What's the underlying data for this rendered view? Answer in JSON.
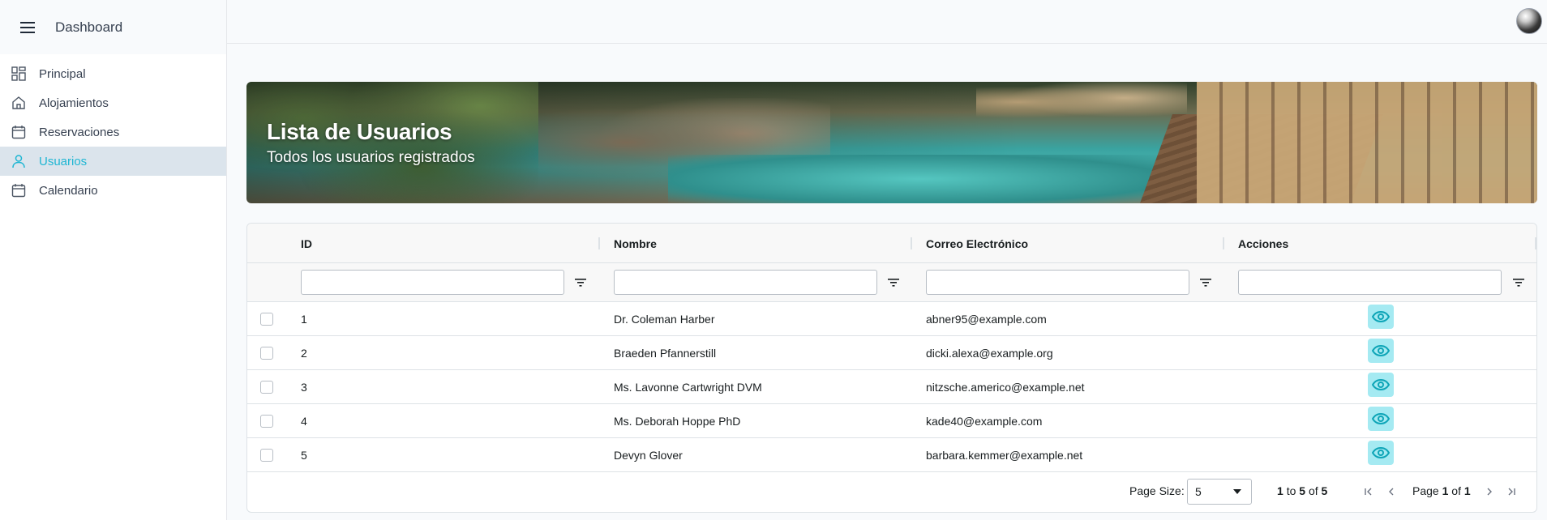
{
  "sidebar": {
    "brand": "Dashboard",
    "items": [
      {
        "label": "Principal",
        "icon": "grid-icon",
        "active": false
      },
      {
        "label": "Alojamientos",
        "icon": "home-icon",
        "active": false
      },
      {
        "label": "Reservaciones",
        "icon": "calendar-icon",
        "active": false
      },
      {
        "label": "Usuarios",
        "icon": "user-icon",
        "active": true
      },
      {
        "label": "Calendario",
        "icon": "calendar-icon",
        "active": false
      }
    ]
  },
  "banner": {
    "title": "Lista de Usuarios",
    "subtitle": "Todos los usuarios registrados"
  },
  "table": {
    "columns": [
      "ID",
      "Nombre",
      "Correo Electrónico",
      "Acciones"
    ],
    "rows": [
      {
        "id": "1",
        "name": "Dr. Coleman Harber",
        "email": "abner95@example.com"
      },
      {
        "id": "2",
        "name": "Braeden Pfannerstill",
        "email": "dicki.alexa@example.org"
      },
      {
        "id": "3",
        "name": "Ms. Lavonne Cartwright DVM",
        "email": "nitzsche.americo@example.net"
      },
      {
        "id": "4",
        "name": "Ms. Deborah Hoppe PhD",
        "email": "kade40@example.com"
      },
      {
        "id": "5",
        "name": "Devyn Glover",
        "email": "barbara.kemmer@example.net"
      }
    ]
  },
  "pager": {
    "page_size_label": "Page Size:",
    "page_size": "5",
    "from": "1",
    "to_word": "to",
    "to": "5",
    "of_word": "of",
    "total": "5",
    "page_word": "Page",
    "page": "1",
    "page_of_word": "of",
    "pages": "1"
  },
  "colors": {
    "accent": "#1fb6d3",
    "active_bg": "#dbe4ec",
    "action_button": "#a5eaf2"
  }
}
